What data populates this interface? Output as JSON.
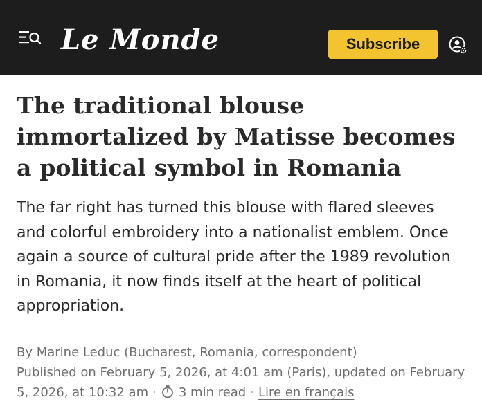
{
  "header": {
    "logo_text": "Le Monde",
    "subscribe_label": "Subscribe",
    "icons": [
      "menu-search-icon",
      "account-settings-icon"
    ],
    "colors": {
      "bar": "#1d1d1d",
      "subscribe_bg": "#f4c430"
    }
  },
  "article": {
    "title": "The traditional blouse immortalized by Matisse becomes a political symbol in Romania",
    "deck": "The far right has turned this blouse with flared sleeves and colorful embroidery into a nationalist emblem. Once again a source of cultural pride after the 1989 revolution in Romania, it now finds itself at the heart of political appropriation.",
    "byline": "By Marine Leduc (Bucharest, Romania, correspondent)",
    "published": "Published on February 5, 2026, at 4:01 am (Paris), updated on February 5, 2026, at 10:32 am",
    "read_time": "3 min read",
    "read_time_icon": "timer-icon",
    "french_link": "Lire en français"
  }
}
